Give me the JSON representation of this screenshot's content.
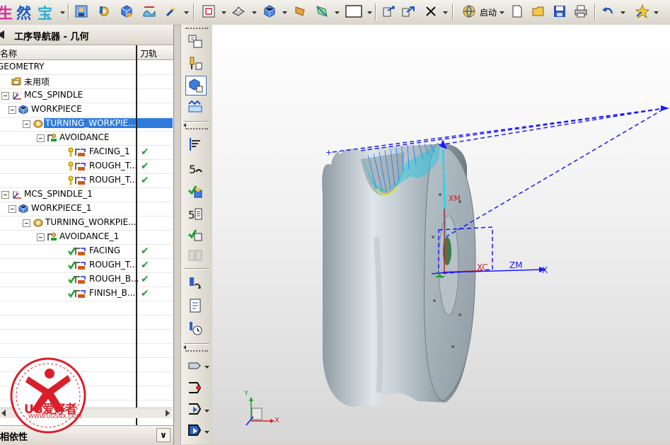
{
  "toolbar": {
    "brand_chars": [
      "生",
      "然",
      "宝"
    ],
    "start_label": "启动",
    "icons": [
      "user-icon",
      "gear-icon",
      "cube-icon",
      "surface-icon",
      "wizard-icon",
      "zoom-fit-icon",
      "shading-icon",
      "view-cube-icon",
      "paint-icon",
      "plane-icon",
      "frame-icon",
      "move-icon",
      "move-multi-icon",
      "close-x-icon",
      "globe-icon",
      "new-doc-icon",
      "open-folder-icon",
      "save-icon",
      "print-icon",
      "undo-icon",
      "star-icon"
    ]
  },
  "navigator": {
    "title": "工序导航器 - 几何",
    "columns": {
      "name": "名称",
      "toolpath": "刀轨"
    },
    "rows": [
      {
        "label": "GEOMETRY",
        "depth": 0,
        "icon": "none",
        "check": false
      },
      {
        "label": "未用项",
        "depth": 1,
        "icon": "folder",
        "check": false
      },
      {
        "label": "MCS_SPINDLE",
        "depth": 1,
        "icon": "mcs",
        "check": false
      },
      {
        "label": "WORKPIECE",
        "depth": 2,
        "icon": "workpiece",
        "check": false
      },
      {
        "label": "TURNING_WORKPIE...",
        "depth": 3,
        "icon": "turning",
        "check": false,
        "selected": true
      },
      {
        "label": "AVOIDANCE",
        "depth": 4,
        "icon": "avoid",
        "check": false
      },
      {
        "label": "FACING_1",
        "depth": 5,
        "icon": "op-warn",
        "check": true
      },
      {
        "label": "ROUGH_T...",
        "depth": 5,
        "icon": "op-warn",
        "check": true
      },
      {
        "label": "ROUGH_T...",
        "depth": 5,
        "icon": "op-warn",
        "check": true
      },
      {
        "label": "MCS_SPINDLE_1",
        "depth": 1,
        "icon": "mcs",
        "check": false
      },
      {
        "label": "WORKPIECE_1",
        "depth": 2,
        "icon": "workpiece",
        "check": false
      },
      {
        "label": "TURNING_WORKPIE...",
        "depth": 3,
        "icon": "turning",
        "check": false
      },
      {
        "label": "AVOIDANCE_1",
        "depth": 4,
        "icon": "avoid",
        "check": false
      },
      {
        "label": "FACING",
        "depth": 5,
        "icon": "op-ok",
        "check": true
      },
      {
        "label": "ROUGH_T...",
        "depth": 5,
        "icon": "op-ok",
        "check": true
      },
      {
        "label": "ROUGH_B...",
        "depth": 5,
        "icon": "op-ok",
        "check": true
      },
      {
        "label": "FINISH_B...",
        "depth": 5,
        "icon": "op-ok",
        "check": true
      }
    ],
    "check_glyph": "✔",
    "dependencies_label": "相依性",
    "expand_glyph": "∨"
  },
  "logo": {
    "text": "UG爱好者",
    "url": "WWW.UGSNX.COM"
  },
  "viewport": {
    "labels": {
      "xm": "XM",
      "xc": "XC",
      "zm": "ZM",
      "x": "X",
      "y": "Y",
      "triad_x": "X",
      "triad_y": "Y"
    },
    "colors": {
      "toolpath": "#1a1aff",
      "axis_x": "#cc2222",
      "part": "#aab6bd"
    }
  }
}
